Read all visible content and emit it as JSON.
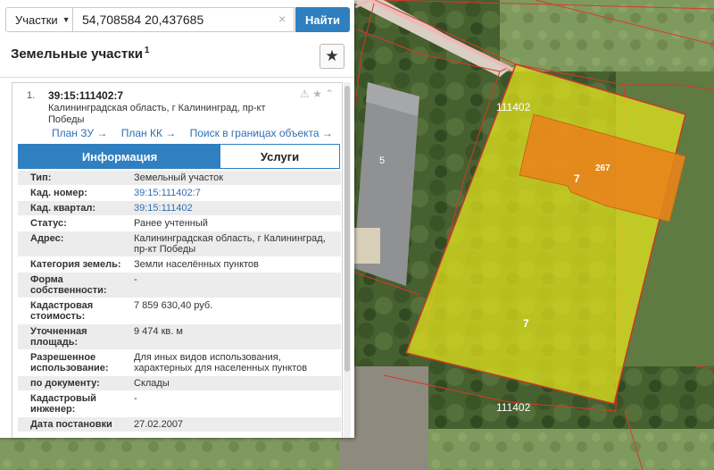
{
  "search": {
    "type_label": "Участки",
    "value": "54,708584 20,437685",
    "clear_glyph": "×",
    "button_label": "Найти"
  },
  "layer": {
    "title": "Земельные участки",
    "count": "1",
    "star_glyph": "★"
  },
  "result": {
    "index": "1.",
    "cadastral_number": "39:15:111402:7",
    "address": "Калининградская область, г Калининград, пр-кт Победы",
    "icons": "⚠ ★ ⌃",
    "links": [
      "План ЗУ →",
      "План КК →",
      "Поиск в границах объекта →"
    ]
  },
  "tabs": {
    "info": "Информация",
    "services": "Услуги"
  },
  "properties": [
    {
      "key": "Тип:",
      "value": "Земельный участок"
    },
    {
      "key": "Кад. номер:",
      "value": "39:15:111402:7"
    },
    {
      "key": "Кад. квартал:",
      "value": "39:15:111402"
    },
    {
      "key": "Статус:",
      "value": "Ранее учтенный"
    },
    {
      "key": "Адрес:",
      "value": "Калининградская область, г Калининград, пр-кт Победы"
    },
    {
      "key": "Категория земель:",
      "value": "Земли населённых пунктов"
    },
    {
      "key": "Форма собственности:",
      "value": "-"
    },
    {
      "key": "Кадастровая стоимость:",
      "value": "7 859 630,40 руб."
    },
    {
      "key": "Уточненная площадь:",
      "value": "9 474 кв. м"
    },
    {
      "key": "Разрешенное использование:",
      "value": "Для иных видов использования, характерных для населенных пунктов"
    },
    {
      "key": "по документу:",
      "value": "Склады"
    },
    {
      "key": "Кадастровый инженер:",
      "value": "-"
    },
    {
      "key": "Дата постановки",
      "value": "27.02.2007"
    }
  ],
  "map": {
    "labels": {
      "quarter_top": "111402",
      "quarter_bottom": "111402",
      "parcel_main": "7",
      "parcel_orange": "7",
      "building": "267",
      "building_left": "5"
    },
    "colors": {
      "parcel_fill": "#e8e81c",
      "building_fill": "#e8841c",
      "boundary": "#d63a2a",
      "road": "#f0b8b8"
    }
  }
}
